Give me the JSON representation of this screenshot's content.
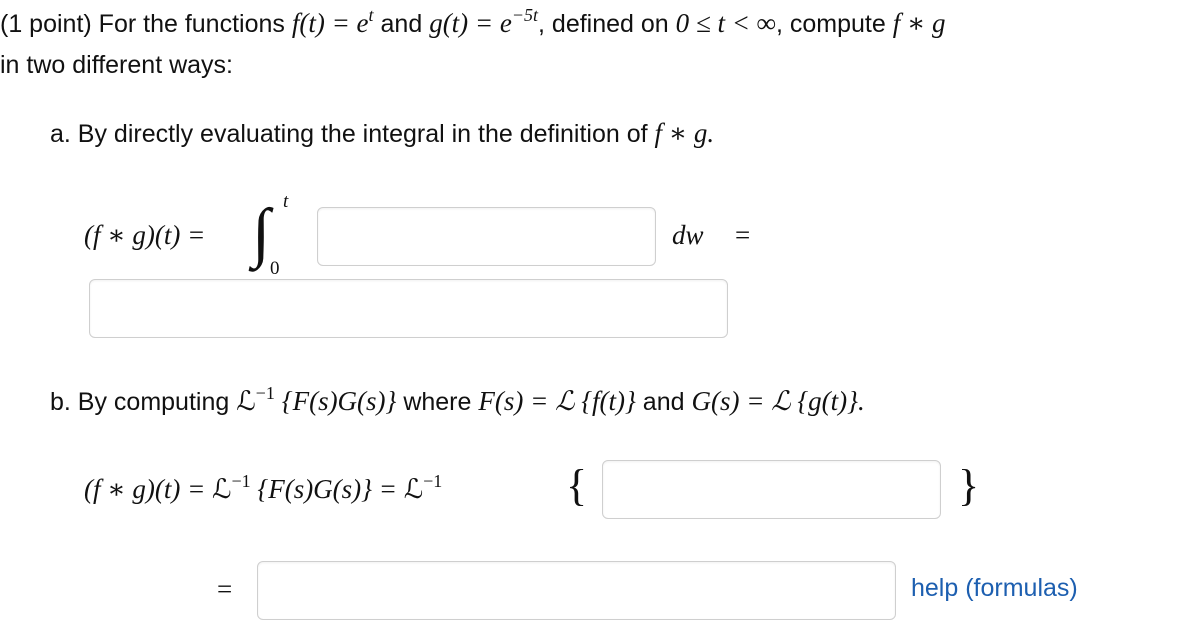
{
  "problem": {
    "points": "(1 point)",
    "intro": "For the functions",
    "f_def": "f(t) = e",
    "f_exp": "t",
    "and_word": "and",
    "g_def": "g(t) = e",
    "g_exp": "−5t",
    "domain_text": ", defined on",
    "domain_math": "0 ≤ t < ∞",
    "compute_text": ", compute",
    "fg": "f ∗ g",
    "line2": "in two different ways:"
  },
  "part_a": {
    "label": "a. By directly evaluating the integral in the definition of",
    "fg": "f ∗ g.",
    "lhs": "(f ∗ g)(t) =",
    "integral_symbol": "∫",
    "upper_limit": "t",
    "lower_limit": "0",
    "dw": "dw",
    "equals": "=",
    "integrand_value": "",
    "result_value": ""
  },
  "part_b": {
    "label_prefix": "b. By computing",
    "linv": "ℒ",
    "linv_exp": "−1",
    "product": "{F(s)G(s)}",
    "where_word": "where",
    "F_def": "F(s) = ℒ {f(t)}",
    "and_word": "and",
    "G_def": "G(s) = ℒ {g(t)}.",
    "lhs": "(f ∗ g)(t) =",
    "linv2": "ℒ",
    "linv2_exp": "−1",
    "product2": "{F(s)G(s)} =",
    "linv3": "ℒ",
    "linv3_exp": "−1",
    "open_brace": "{",
    "close_brace": "}",
    "equals2": "=",
    "transform_value": "",
    "final_value": ""
  },
  "help": {
    "label": "help (formulas)"
  },
  "colors": {
    "text": "#111111",
    "link": "#1d5fb0",
    "box_border": "#cfcfcf"
  }
}
